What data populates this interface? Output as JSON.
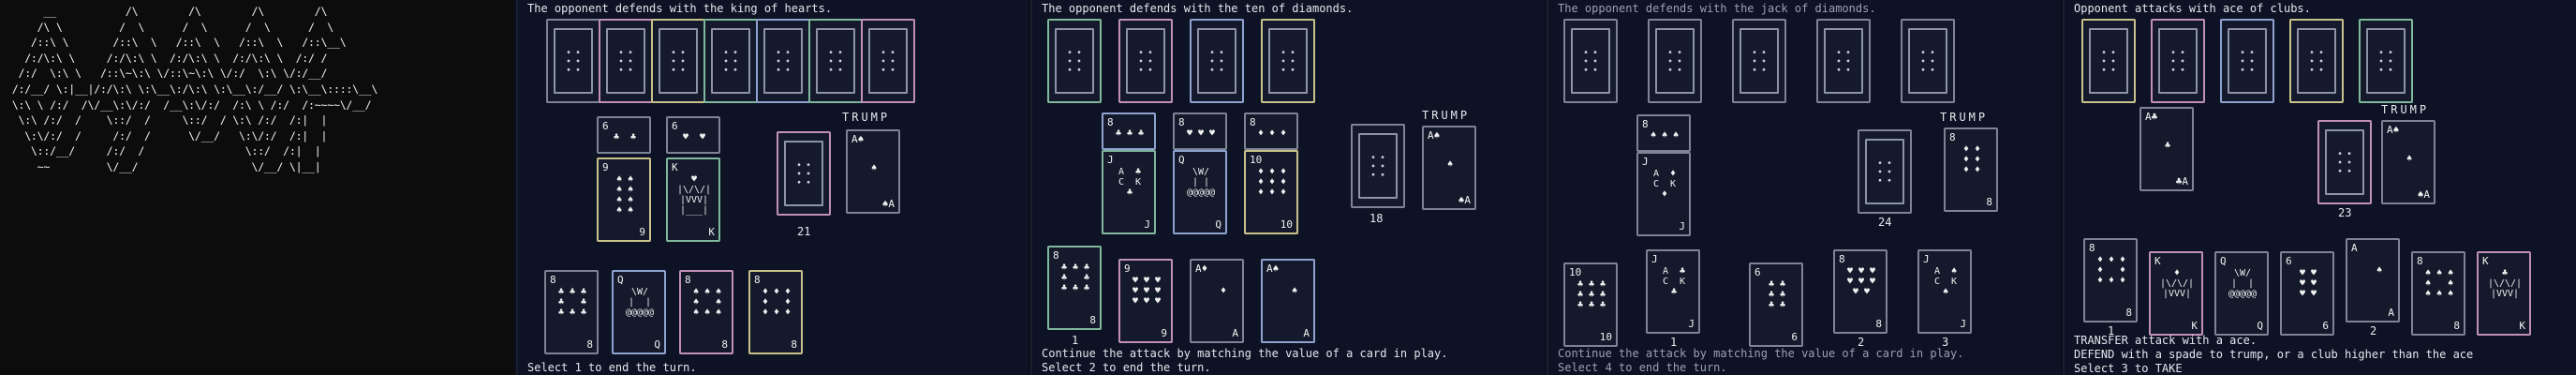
{
  "banner": {
    "ascii": "      __           /\\        /\\        /\\        /\\\n     /\\ \\         /  \\      /  \\      /  \\      /  \\\n    /::\\ \\       /::\\  \\   /::\\  \\   /::\\  \\   /::\\__\\\n   /:/\\:\\ \\     /:/\\:\\ \\  /:/\\:\\ \\  /:/\\:\\ \\  /:/ /\n  /:/  \\:\\ \\   /::\\~\\:\\ \\/::\\~\\:\\ \\/:/  \\:\\ \\/:/__/\n /:/__/ \\:|__|/:/\\:\\ \\:\\__\\:/\\:\\ \\:\\__\\:/__/ \\:\\__\\::::\\__\\\n \\:\\ \\ /:/  /\\/__\\:\\/:/  /__\\:\\/:/  /:\\ \\ /:/  /:~~~~\\/__/\n  \\:\\ /:/  /    \\::/  /     \\::/  / \\:\\ /:/  /:|  |\n   \\:\\/:/  /     /:/  /      \\/__/   \\:\\/:/  /:|  |\n    \\::/__/     /:/  /                \\::/  /:|  |\n     ~~         \\/__/                  \\/__/ \\|__|"
  },
  "panels": [
    {
      "id": "g1",
      "message": "The opponent defends with the king of hearts.",
      "footer": "Select 1 to end the turn.",
      "deck_count": "21",
      "trump_label": "TRUMP",
      "trump_card": {
        "rank": "A",
        "suit": "♠",
        "bottom": "A"
      },
      "opponent_hand_count": 7,
      "table": [
        {
          "attack": {
            "rank": "6",
            "art": "♣  ♣"
          },
          "defend": {
            "rank": "9",
            "art": "♠ ♠\n♠ ♠\n♠ ♠\n♠ ♠",
            "bottom": "9"
          }
        },
        {
          "attack": {
            "rank": "6",
            "art": "♥  ♥"
          },
          "defend": {
            "rank": "K",
            "art": "♥\n|\\/\\/|\n|VVV|\n|___|",
            "bottom": "K"
          }
        }
      ],
      "hand": [
        {
          "rank": "8",
          "art": "♣ ♣ ♣\n♣   ♣\n♣ ♣ ♣",
          "bottom": "8"
        },
        {
          "rank": "Q",
          "art": "\\W/\n|  |\n@@@@@",
          "bottom": "Q"
        },
        {
          "rank": "8",
          "art": "♠ ♠ ♠\n♠   ♠\n♠ ♠ ♠",
          "bottom": "8"
        },
        {
          "rank": "8",
          "art": "♦ ♦ ♦\n♦   ♦\n♦ ♦ ♦",
          "bottom": "8"
        }
      ]
    },
    {
      "id": "g2",
      "message": "The opponent defends with the ten of diamonds.",
      "footer1": "Continue the attack by matching the value of a card in play.",
      "footer2": "Select 2 to end the turn.",
      "deck_count": "18",
      "trump_label": "TRUMP",
      "trump_card": {
        "rank": "A",
        "suit": "♠",
        "bottom": "A"
      },
      "hand_index_label": "1",
      "table": [
        {
          "attack": {
            "rank": "8",
            "art": "♣ ♣ ♣"
          },
          "defend": {
            "rank": "J",
            "art": "A  ♣\nC  K\n♣",
            "bottom": "J"
          }
        },
        {
          "attack": {
            "rank": "8",
            "art": "♥ ♥ ♥"
          },
          "defend": {
            "rank": "Q",
            "art": "\\W/\n| |\n@@@@@",
            "bottom": "Q"
          }
        },
        {
          "attack": {
            "rank": "8",
            "art": "♦ ♦ ♦"
          },
          "defend": {
            "rank": "10",
            "art": "♦ ♦ ♦\n♦ ♦ ♦\n♦ ♦ ♦",
            "bottom": "10"
          }
        }
      ],
      "hand": [
        {
          "rank": "8",
          "art": "♣ ♣ ♣\n♣   ♣\n♣ ♣ ♣",
          "bottom": "8"
        },
        {
          "rank": "9",
          "art": "♥ ♥ ♥\n♥ ♥ ♥\n♥ ♥ ♥",
          "bottom": "9"
        },
        {
          "rank": "A",
          "suit": "♦",
          "art": "\n  ♦",
          "bottom": "A"
        },
        {
          "rank": "A",
          "suit": "♠",
          "art": "\n  ♠",
          "bottom": "A"
        }
      ]
    },
    {
      "id": "g3",
      "message": "The opponent defends with the jack of diamonds.",
      "footer1": "Continue the attack by matching the value of a card in play.",
      "footer2": "Select 4 to end the turn.",
      "deck_count": "24",
      "trump_label": "TRUMP",
      "trump_card": {
        "rank": "8",
        "art": "♦ ♦\n♦ ♦\n♦ ♦",
        "bottom": "8"
      },
      "table": [
        {
          "attack": {
            "rank": "8",
            "art": "♠ ♠ ♠"
          },
          "defend": {
            "rank": "J",
            "art": "A  ♦\nC  K\n♦",
            "bottom": "J"
          }
        }
      ],
      "hand_labels": [
        "1",
        "2",
        "3"
      ],
      "hand": [
        {
          "rank": "10",
          "art": "♣ ♣ ♣\n♣ ♣ ♣\n♣ ♣ ♣",
          "bottom": "10"
        },
        {
          "rank": "J",
          "art": "A  ♣\nC  K\n♣",
          "bottom": "J"
        },
        {
          "rank": "6",
          "art": "♣ ♣\n♣ ♣\n♣ ♣",
          "bottom": "6"
        },
        {
          "rank": "8",
          "art": "♥ ♥ ♥\n♥ ♥ ♥\n♥ ♥",
          "bottom": "8"
        },
        {
          "rank": "J",
          "art": "A  ♠\nC  K\n♠",
          "bottom": "J"
        }
      ]
    },
    {
      "id": "g4",
      "message": "Opponent attacks with ace of clubs.",
      "footer1": "TRANSFER attack with a ace.",
      "footer2": "DEFEND with a spade to trump, or a club higher than the ace",
      "footer3": "Select 3 to TAKE",
      "deck_count": "23",
      "trump_label": "TRUMP",
      "trump_card": {
        "rank": "A",
        "suit": "♠",
        "bottom": "A"
      },
      "table_card": {
        "rank": "A",
        "suit": "♣",
        "bottom": "A"
      },
      "hand_labels": [
        "1",
        "2"
      ],
      "hand": [
        {
          "rank": "8",
          "art": "♦ ♦ ♦\n♦   ♦\n♦ ♦ ♦",
          "bottom": "8"
        },
        {
          "rank": "K",
          "art": "♦\n|\\/\\/|\n|VVV|",
          "bottom": "K"
        },
        {
          "rank": "Q",
          "art": "\\W/\n|  |\n@@@@@",
          "bottom": "Q"
        },
        {
          "rank": "6",
          "art": "♥ ♥\n♥ ♥\n♥ ♥",
          "bottom": "6"
        },
        {
          "rank": "A",
          "art": "\n  ♠",
          "bottom": "A"
        },
        {
          "rank": "8",
          "art": "♠ ♠ ♠\n♠   ♠\n♠ ♠ ♠",
          "bottom": "8"
        },
        {
          "rank": "K",
          "art": "♣\n|\\/\\/|\n|VVV|",
          "bottom": "K"
        }
      ]
    }
  ]
}
